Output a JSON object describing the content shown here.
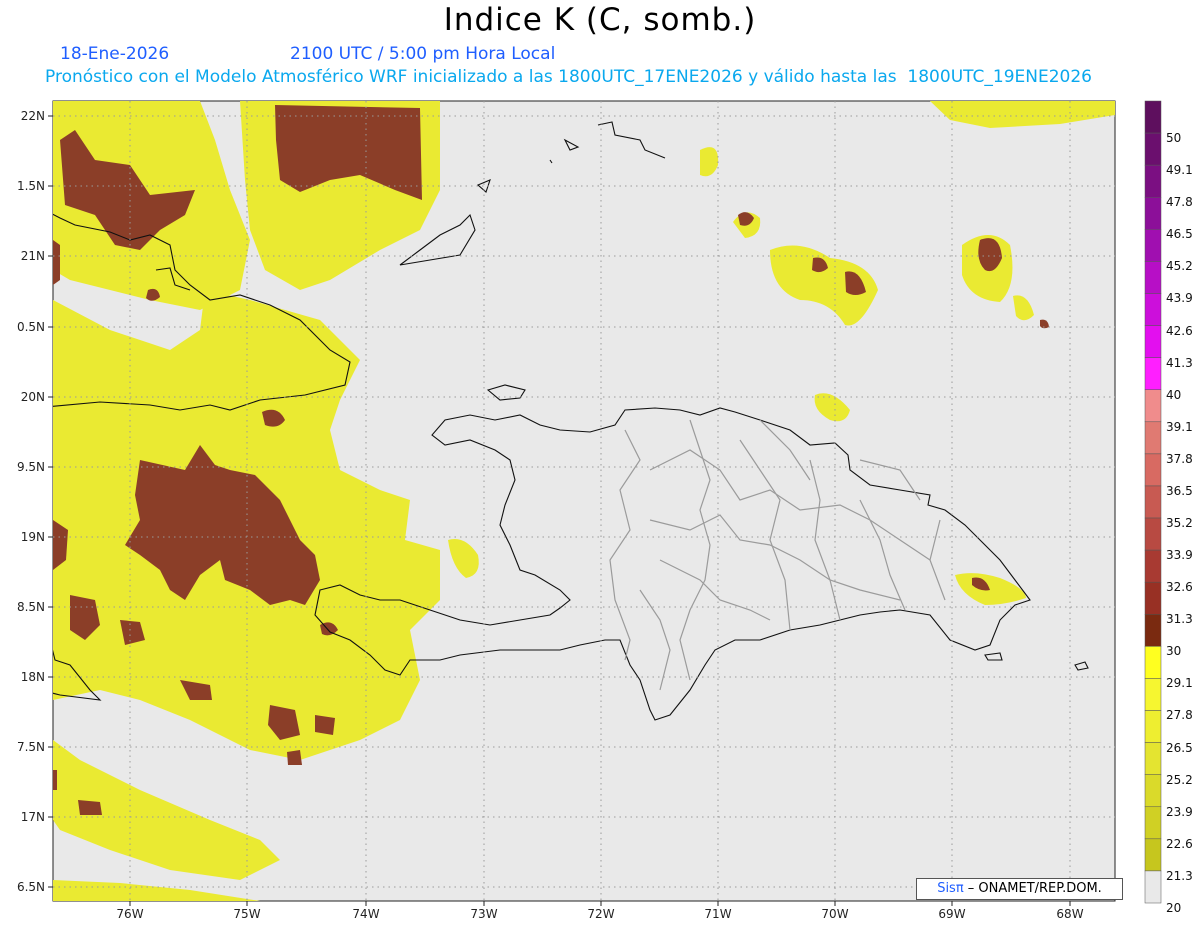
{
  "title": "Indice K (C, somb.)",
  "date": "18-Ene-2026",
  "time": "2100 UTC / 5:00 pm Hora Local",
  "forecast": "Pronóstico con el Modelo Atmosférico WRF inicializado a las 1800UTC_17ENE2026 y válido hasta las  1800UTC_19ENE2026",
  "lat_labels": [
    "22N",
    "1.5N",
    "21N",
    "0.5N",
    "20N",
    "9.5N",
    "19N",
    "8.5N",
    "18N",
    "7.5N",
    "17N",
    "6.5N"
  ],
  "lon_labels": [
    "76W",
    "75W",
    "74W",
    "73W",
    "72W",
    "71W",
    "70W",
    "69W",
    "68W"
  ],
  "colorbar": {
    "labels": [
      "50",
      "49.1",
      "47.8",
      "46.5",
      "45.2",
      "43.9",
      "42.6",
      "41.3",
      "40",
      "39.1",
      "37.8",
      "36.5",
      "35.2",
      "33.9",
      "32.6",
      "31.3",
      "30",
      "29.1",
      "27.8",
      "26.5",
      "25.2",
      "23.9",
      "22.6",
      "21.3",
      "20"
    ],
    "colors": [
      "#5e0f5e",
      "#6b0f6e",
      "#7b0f82",
      "#8c0f99",
      "#a00fb0",
      "#b70fc6",
      "#cc0fdb",
      "#e30fef",
      "#ff1fff",
      "#f08c8c",
      "#e07a72",
      "#d86a62",
      "#c85a52",
      "#b84a42",
      "#a83a32",
      "#983024",
      "#7a2a10",
      "#ffff20",
      "#f6f630",
      "#eeee30",
      "#e4e430",
      "#dada2a",
      "#d0d024",
      "#c6c61e",
      "#bcbc18"
    ]
  },
  "credit": {
    "brand": "Sisπ",
    "org": " – ONAMET/REP.DOM."
  },
  "colors": {
    "ocean": "#e9e9e9",
    "yellow": "#eaea32",
    "brown": "#8b3e28"
  }
}
